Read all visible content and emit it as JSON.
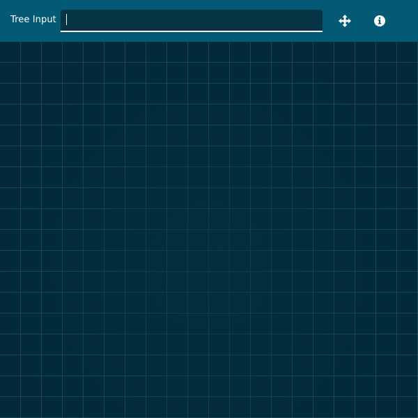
{
  "toolbar": {
    "label": "Tree Input",
    "input_value": "",
    "input_placeholder": "",
    "move_button_icon": "move-arrows-icon",
    "info_button_icon": "info-circle-icon"
  },
  "colors": {
    "toolbar_bg": "#045a75",
    "input_bg": "#063444",
    "canvas_bg": "#03293a",
    "grid_line": "#2d6e7d",
    "icon": "#ffffff"
  }
}
